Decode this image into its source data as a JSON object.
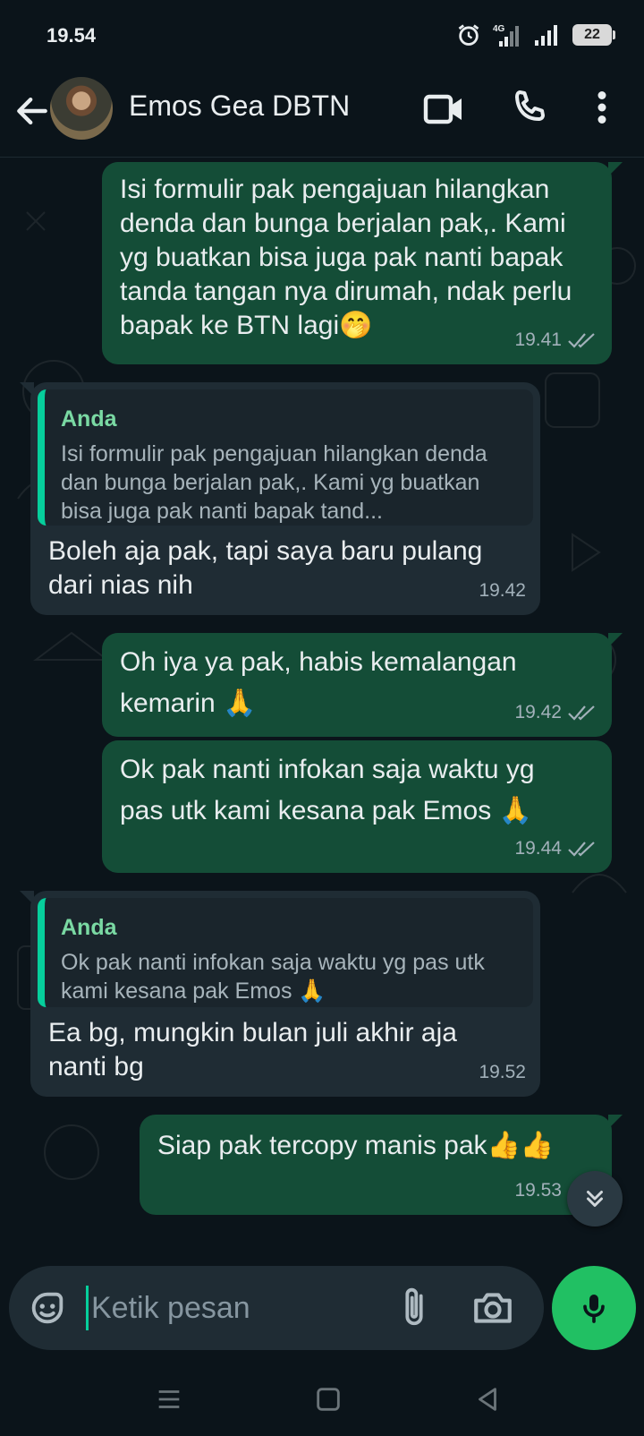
{
  "status_bar": {
    "time": "19.54",
    "network": "4G",
    "battery": "22"
  },
  "header": {
    "contact_name": "Emos Gea DBTN",
    "icons": [
      "back-arrow-icon",
      "video-call-icon",
      "phone-icon",
      "more-vert-icon"
    ]
  },
  "messages": [
    {
      "direction": "out",
      "text": "Isi formulir pak pengajuan hilangkan denda dan bunga berjalan pak,. Kami yg buatkan bisa juga pak nanti bapak tanda tangan nya dirumah, ndak perlu bapak ke BTN lagi🤭",
      "time": "19.41",
      "status": "read"
    },
    {
      "direction": "in",
      "quote_author": "Anda",
      "quote_text": "Isi formulir pak pengajuan hilangkan denda dan bunga berjalan pak,. Kami yg buatkan bisa juga pak nanti bapak tand...",
      "text": "Boleh aja pak, tapi saya baru pulang dari nias nih",
      "time": "19.42"
    },
    {
      "direction": "out",
      "text": "Oh iya ya pak, habis kemalangan kemarin 🙏",
      "time": "19.42",
      "status": "read"
    },
    {
      "direction": "out",
      "text": "Ok pak nanti infokan saja waktu yg pas utk kami kesana pak Emos 🙏",
      "time": "19.44",
      "status": "read"
    },
    {
      "direction": "in",
      "quote_author": "Anda",
      "quote_text": "Ok pak nanti infokan saja waktu yg pas utk kami kesana pak Emos 🙏",
      "text": "Ea bg, mungkin bulan juli akhir aja nanti bg",
      "time": "19.52"
    },
    {
      "direction": "out",
      "text": "Siap pak tercopy manis pak👍👍",
      "time": "19.53",
      "status": "read"
    }
  ],
  "composer": {
    "placeholder": "Ketik pesan"
  },
  "colors": {
    "background": "#0b141a",
    "outgoing_bubble": "#144d37",
    "incoming_bubble": "#1f2c34",
    "accent": "#21c063",
    "quote_bar": "#06cf9c"
  }
}
